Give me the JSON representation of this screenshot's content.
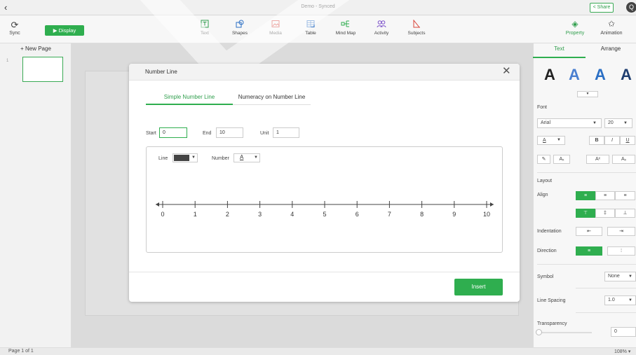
{
  "titlebar": {
    "back_icon": "chevron-left-icon",
    "title": "Demo - Synced",
    "share_label": "Share",
    "user_initial": "Q"
  },
  "toolbar": {
    "sync_label": "Sync",
    "display_label": "Display",
    "tools": [
      {
        "label": "Text",
        "icon": "text-icon"
      },
      {
        "label": "Shapes",
        "icon": "shapes-icon"
      },
      {
        "label": "Media",
        "icon": "media-icon"
      },
      {
        "label": "Table",
        "icon": "table-icon"
      },
      {
        "label": "Mind Map",
        "icon": "mind-map-icon"
      },
      {
        "label": "Activity",
        "icon": "activity-icon"
      },
      {
        "label": "Subjects",
        "icon": "subjects-icon"
      }
    ],
    "property_label": "Property",
    "animation_label": "Animation"
  },
  "pages": {
    "new_page_label": "+ New Page",
    "thumb_number": "1"
  },
  "status": {
    "page_of": "Page 1 of 1",
    "zoom": "108%"
  },
  "dialog": {
    "title": "Number Line",
    "tabs": [
      "Simple Number Line",
      "Numeracy on Number Line"
    ],
    "start_label": "Start",
    "start_value": "0",
    "end_label": "End",
    "end_value": "10",
    "unit_label": "Unit",
    "unit_value": "1",
    "line_label": "Line",
    "number_label": "Number",
    "number_style_glyph": "A",
    "numberline_ticks": [
      "0",
      "1",
      "2",
      "3",
      "4",
      "5",
      "6",
      "7",
      "8",
      "9",
      "10"
    ],
    "insert_label": "Insert"
  },
  "right_panel": {
    "tab_text": "Text",
    "tab_arrange": "Arrange",
    "style_glyph": "A",
    "font_label": "Font",
    "font_name": "Arial",
    "font_size": "20",
    "bold": "B",
    "italic": "I",
    "underline": "U",
    "color_glyph": "A",
    "layout_label": "Layout",
    "align_label": "Align",
    "indentation_label": "Indentation",
    "direction_label": "Direction",
    "symbol_label": "Symbol",
    "symbol_value": "None",
    "line_spacing_label": "Line Spacing",
    "line_spacing_value": "1.0",
    "transparency_label": "Transparency",
    "transparency_value": "0"
  },
  "colors": {
    "accent": "#2fae4f",
    "line_color": "#444444"
  }
}
